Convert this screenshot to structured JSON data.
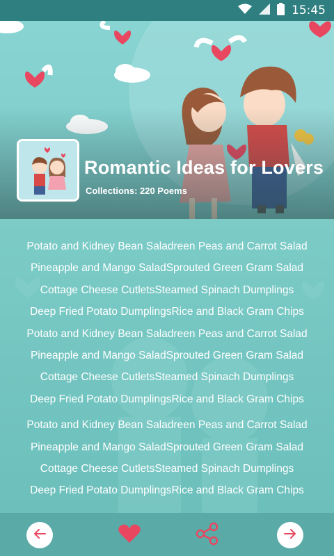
{
  "status_bar": {
    "time": "15:45"
  },
  "header": {
    "title": "Romantic Ideas for Lovers",
    "subtitle": "Collections: 220 Poems"
  },
  "list": {
    "items": [
      "Potato and Kidney Bean Saladreen Peas and Carrot Salad",
      "Pineapple and Mango SaladSprouted Green Gram Salad",
      "Cottage Cheese CutletsSteamed Spinach Dumplings",
      "Deep Fried Potato DumplingsRice and Black Gram Chips",
      "Potato and Kidney Bean Saladreen Peas and Carrot Salad",
      "Pineapple and Mango SaladSprouted Green Gram Salad",
      "Cottage Cheese CutletsSteamed Spinach Dumplings",
      "Deep Fried Potato DumplingsRice and Black Gram Chips",
      "Potato and Kidney Bean Saladreen Peas and Carrot Salad",
      "Pineapple and Mango SaladSprouted Green Gram Salad",
      "Cottage Cheese CutletsSteamed Spinach Dumplings",
      "Deep Fried Potato DumplingsRice and Black Gram Chips"
    ]
  },
  "bottom_bar": {
    "buttons": [
      {
        "name": "previous",
        "icon": "arrow-left-icon"
      },
      {
        "name": "favorite",
        "icon": "heart-icon"
      },
      {
        "name": "share",
        "icon": "share-icon"
      },
      {
        "name": "next",
        "icon": "arrow-right-icon"
      }
    ]
  },
  "colors": {
    "accent": "#e8475f",
    "status_bar": "#2f7f80",
    "background": "#78c8c5",
    "bottom_bar": "#5aaba8"
  }
}
